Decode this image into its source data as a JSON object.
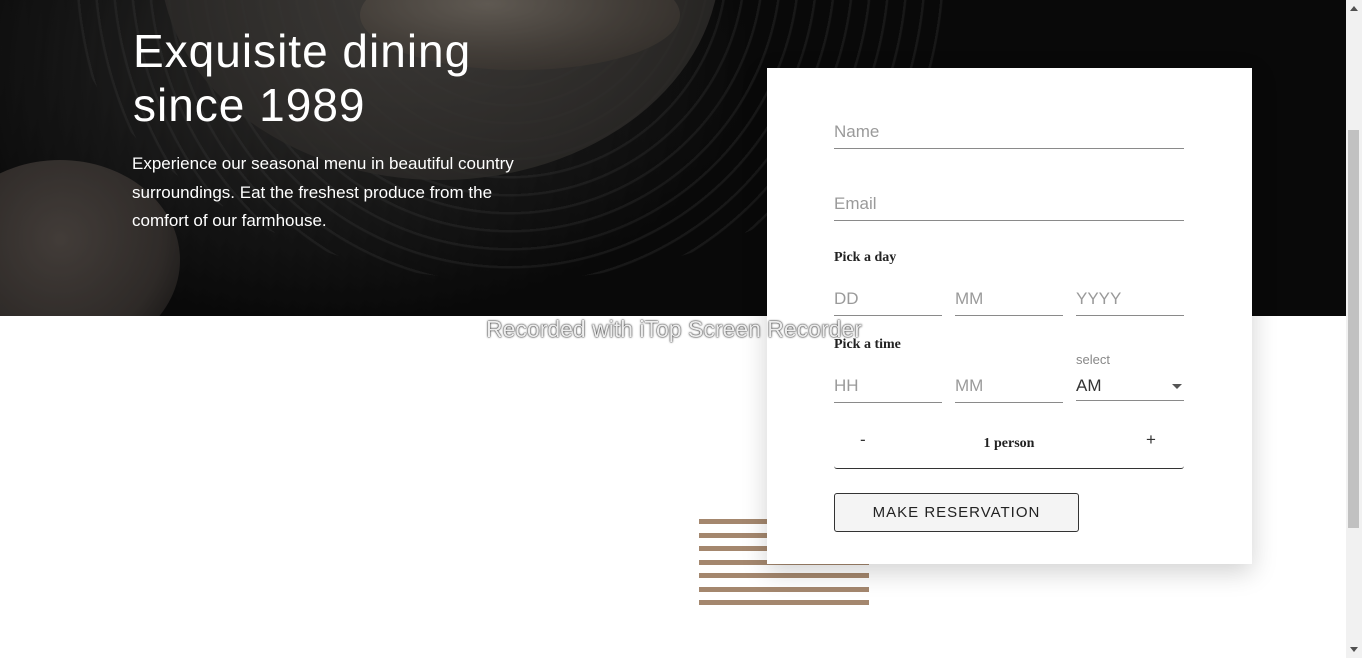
{
  "hero": {
    "title": "Exquisite dining since 1989",
    "text": "Experience our seasonal menu in beautiful country surroundings. Eat the freshest produce from the comfort of our farmhouse."
  },
  "form": {
    "name_placeholder": "Name",
    "email_placeholder": "Email",
    "day_label": "Pick a day",
    "day_placeholder": "DD",
    "month_placeholder": "MM",
    "year_placeholder": "YYYY",
    "time_label": "Pick a time",
    "hour_placeholder": "HH",
    "minute_placeholder": "MM",
    "ampm_hint": "select",
    "ampm_value": "AM",
    "stepper_minus": "-",
    "stepper_plus": "+",
    "stepper_value": "1 person",
    "submit_label": "MAKE RESERVATION"
  },
  "watermark": "Recorded with iTop Screen Recorder",
  "colors": {
    "accent_stripes": "#a4876e"
  }
}
